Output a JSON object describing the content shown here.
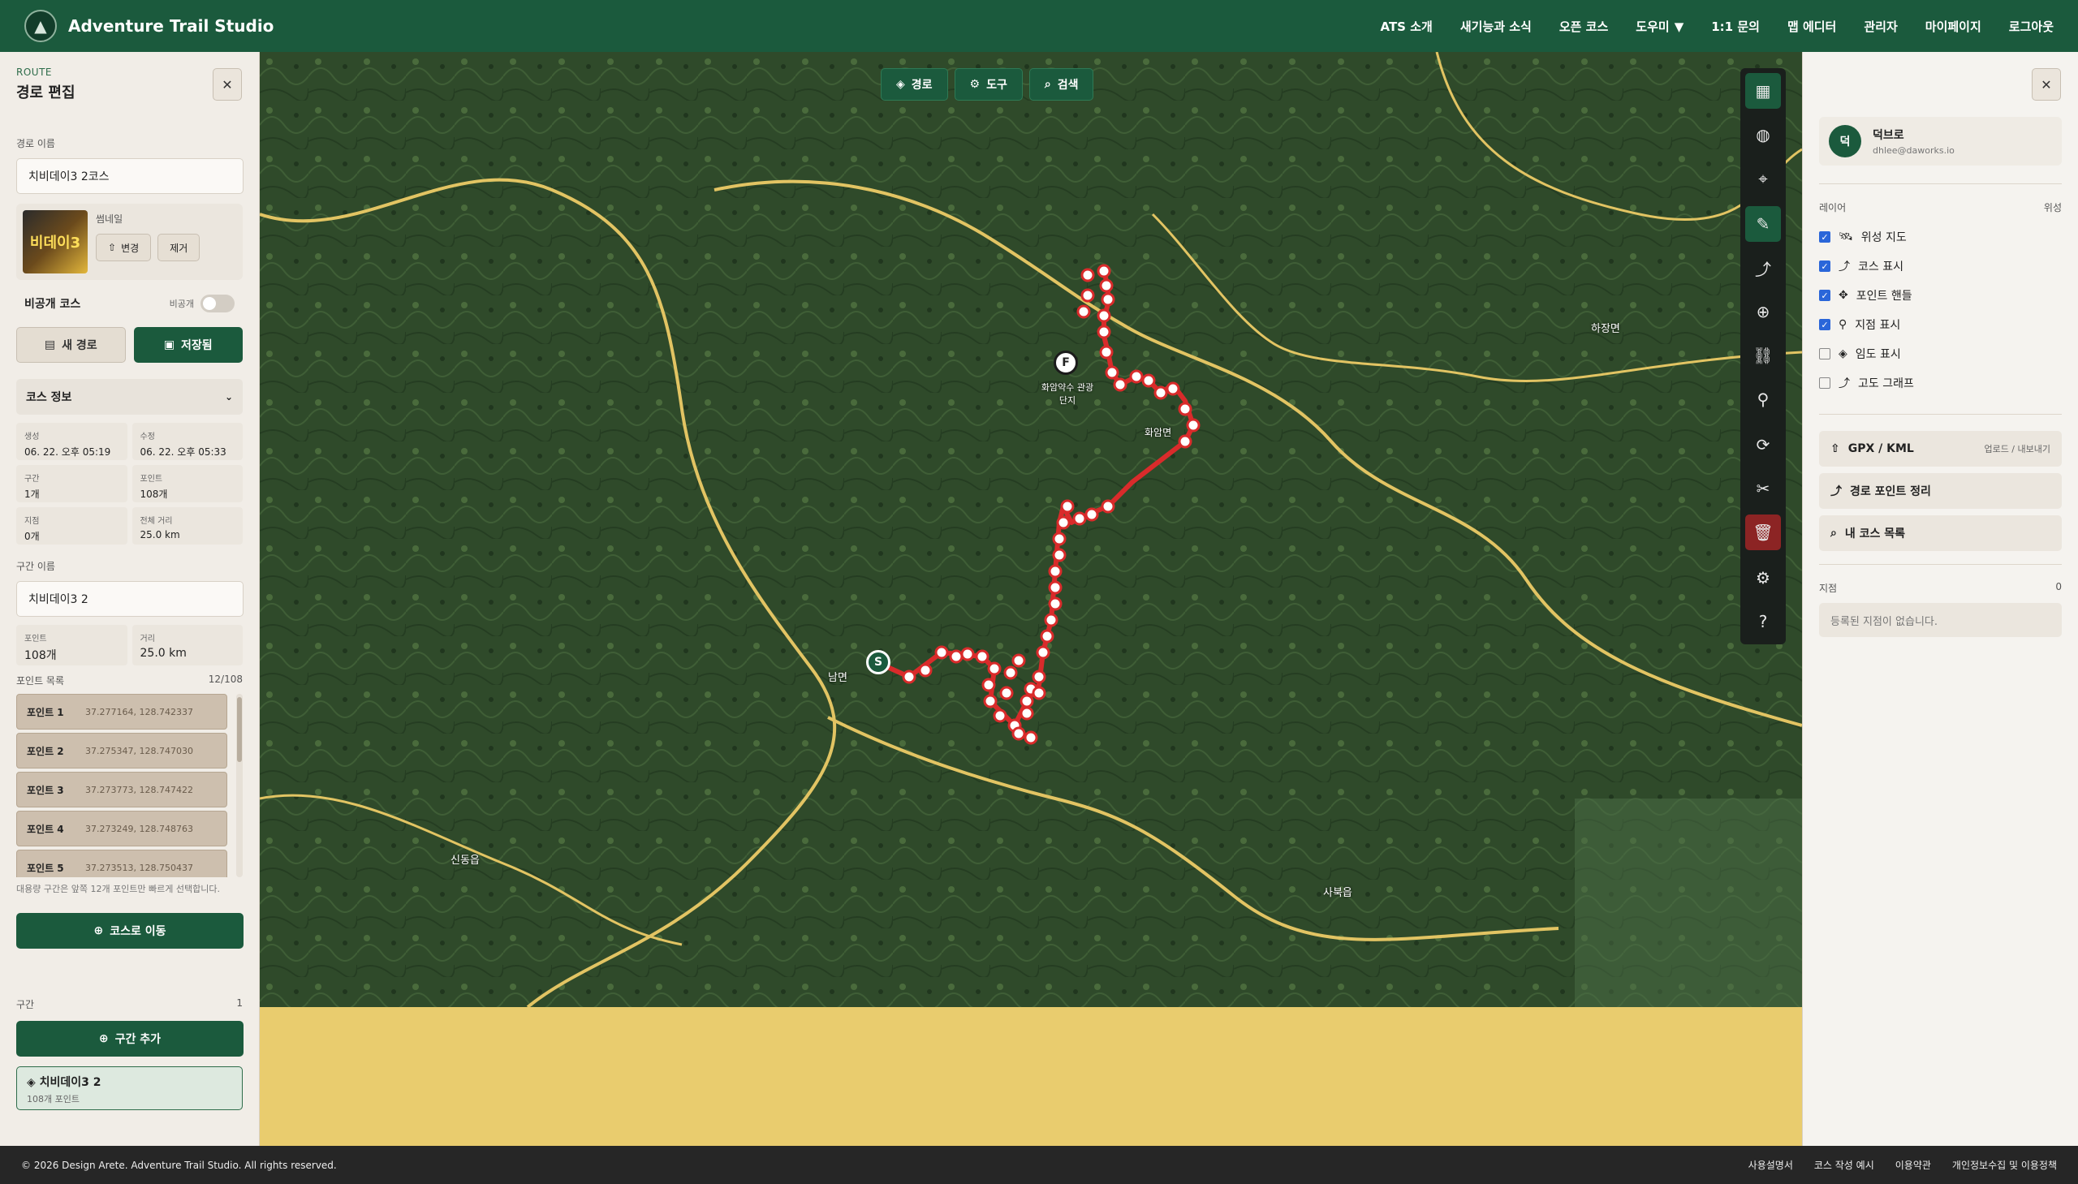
{
  "brand": {
    "name": "Adventure Trail Studio",
    "logo_icon": "mountain-logo"
  },
  "nav": [
    {
      "label": "ATS 소개"
    },
    {
      "label": "새기능과 소식"
    },
    {
      "label": "오픈 코스"
    },
    {
      "label": "도우미",
      "dropdown": true
    },
    {
      "label": "1:1 문의"
    },
    {
      "label": "맵 에디터"
    },
    {
      "label": "관리자"
    },
    {
      "label": "마이페이지"
    },
    {
      "label": "로그아웃"
    }
  ],
  "left": {
    "eyebrow": "ROUTE",
    "title": "경로 편집",
    "route_name_label": "경로 이름",
    "route_name": "치비데이3 2코스",
    "thumb_label": "썸네일",
    "thumb_text": "비데이3",
    "change_label": "변경",
    "remove_label": "제거",
    "private_label": "비공개 코스",
    "private_state": "비공개",
    "new_route_label": "새 경로",
    "saved_label": "저장됨",
    "course_info_label": "코스 정보",
    "stats": {
      "created_k": "생성",
      "created_v": "06. 22. 오후 05:19",
      "modified_k": "수정",
      "modified_v": "06. 22. 오후 05:33",
      "segments_k": "구간",
      "segments_v": "1개",
      "points_k": "포인트",
      "points_v": "108개",
      "waypoints_k": "지점",
      "waypoints_v": "0개",
      "distance_k": "전체 거리",
      "distance_v": "25.0 km"
    },
    "segment_name_label": "구간 이름",
    "segment_name": "치비데이3 2",
    "seg_points_k": "포인트",
    "seg_points_v": "108개",
    "seg_dist_k": "거리",
    "seg_dist_v": "25.0 km",
    "point_list_label": "포인트 목록",
    "point_list_count": "12/108",
    "points": [
      {
        "name": "포인트 1",
        "coord": "37.277164, 128.742337"
      },
      {
        "name": "포인트 2",
        "coord": "37.275347, 128.747030"
      },
      {
        "name": "포인트 3",
        "coord": "37.273773, 128.747422"
      },
      {
        "name": "포인트 4",
        "coord": "37.273249, 128.748763"
      },
      {
        "name": "포인트 5",
        "coord": "37.273513, 128.750437"
      }
    ],
    "list_hint": "대용량 구간은 앞쪽 12개 포인트만 빠르게 선택합니다.",
    "goto_course_label": "코스로 이동",
    "segments_label": "구간",
    "segments_count": "1",
    "add_segment_label": "구간 추가",
    "segment_card_name": "치비데이3 2",
    "segment_card_sub": "108개 포인트"
  },
  "map": {
    "tabs": [
      {
        "label": "경로",
        "icon": "layers-icon"
      },
      {
        "label": "도구",
        "icon": "gear-icon"
      },
      {
        "label": "검색",
        "icon": "search-icon"
      }
    ],
    "start_marker": "S",
    "finish_marker": "F",
    "labels": {
      "namyeon": "남면",
      "hajangmyeon": "하장면",
      "sindong": "신동읍",
      "sabuk": "사북읍",
      "hwaam": "화암약수 관광단지",
      "hwaammyeon": "화암면"
    },
    "route_color": "#d92b2b"
  },
  "right": {
    "user_initial": "덕",
    "user_name": "덕브로",
    "user_email": "dhlee@daworks.io",
    "layers_label": "레이어",
    "layers_right": "위성",
    "layers": [
      {
        "label": "위성 지도",
        "checked": "✓"
      },
      {
        "label": "코스 표시",
        "checked": "✓"
      },
      {
        "label": "포인트 핸들",
        "checked": "✓"
      },
      {
        "label": "지점 표시",
        "checked": "✓"
      },
      {
        "label": "임도 표시",
        "checked": ""
      },
      {
        "label": "고도 그래프",
        "checked": ""
      }
    ],
    "gpx_label": "GPX / KML",
    "gpx_sub": "업로드 / 내보내기",
    "tidy_label": "경로 포인트 정리",
    "mycourse_label": "내 코스 목록",
    "waypoints_label": "지점",
    "waypoints_count": "0",
    "waypoints_empty": "등록된 지점이 없습니다."
  },
  "footer": {
    "copyright": "© 2026 Design Arete. Adventure Trail Studio. All rights reserved.",
    "links": [
      "사용설명서",
      "코스 작성 예시",
      "이용약관",
      "개인정보수집 및 이용정책"
    ]
  }
}
